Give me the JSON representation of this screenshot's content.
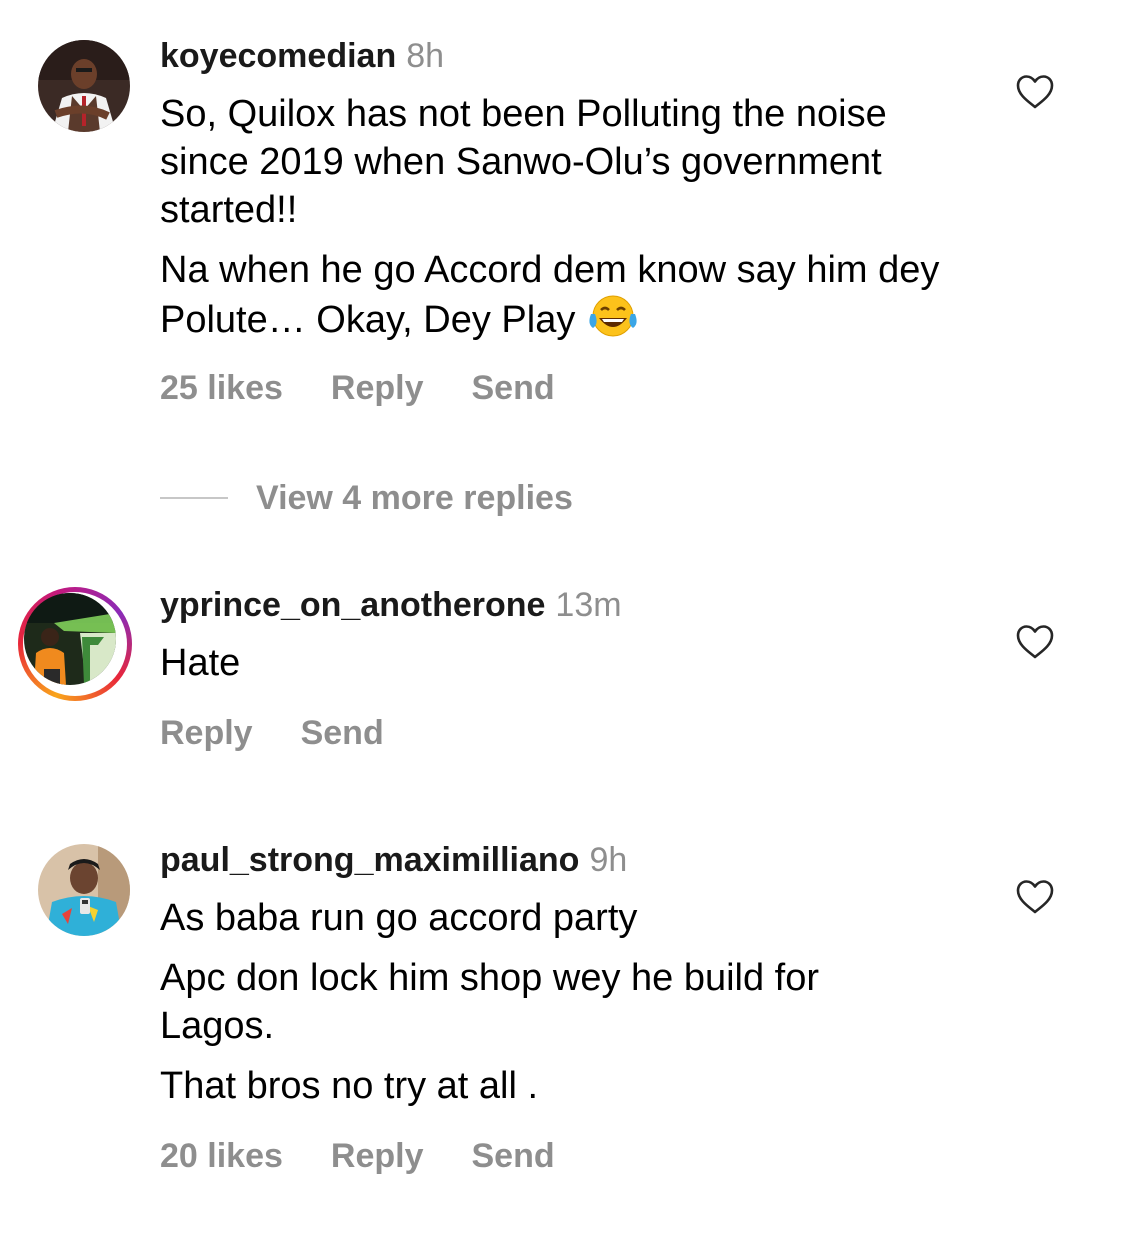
{
  "comments": [
    {
      "username": "koyecomedian",
      "time": "8h",
      "paragraphs": [
        "So, Quilox has not been Polluting the noise since 2019 when Sanwo-Olu’s government started!!",
        "Na when he go Accord dem know say him dey Polute… Okay, Dey Play"
      ],
      "emoji": "face-with-tears-of-joy",
      "likes": "25 likes",
      "reply_label": "Reply",
      "send_label": "Send",
      "view_more": "View 4 more replies"
    },
    {
      "username": "yprince_on_anotherone",
      "time": "13m",
      "paragraphs": [
        "Hate"
      ],
      "reply_label": "Reply",
      "send_label": "Send"
    },
    {
      "username": "paul_strong_maximilliano",
      "time": "9h",
      "paragraphs": [
        "As baba run go accord party",
        "Apc don lock him shop wey he build for Lagos.",
        "That bros no try at all ."
      ],
      "likes": "20 likes",
      "reply_label": "Reply",
      "send_label": "Send"
    }
  ],
  "colors": {
    "meta_gray": "#8e8e8e",
    "heart_stroke": "#262626",
    "story_ring": [
      "#f9a51b",
      "#e8263a",
      "#c2197f"
    ]
  },
  "icons": {
    "like": "heart-outline-icon",
    "emoji": "face-with-tears-of-joy"
  }
}
